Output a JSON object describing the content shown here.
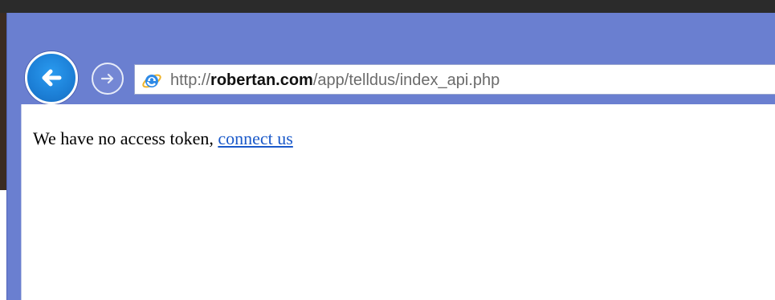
{
  "browser": {
    "address": {
      "prefix": "http://",
      "domain": "robertan.com",
      "path": "/app/telldus/index_api.php"
    },
    "back_icon": "arrow-left-icon",
    "forward_icon": "arrow-right-icon",
    "site_icon": "internet-explorer-icon",
    "colors": {
      "chrome": "#6a7fd0",
      "back_button": "#1c7fd6",
      "link": "#1a59c9"
    }
  },
  "page": {
    "message": "We have no access token, ",
    "link_text": "connect us"
  }
}
